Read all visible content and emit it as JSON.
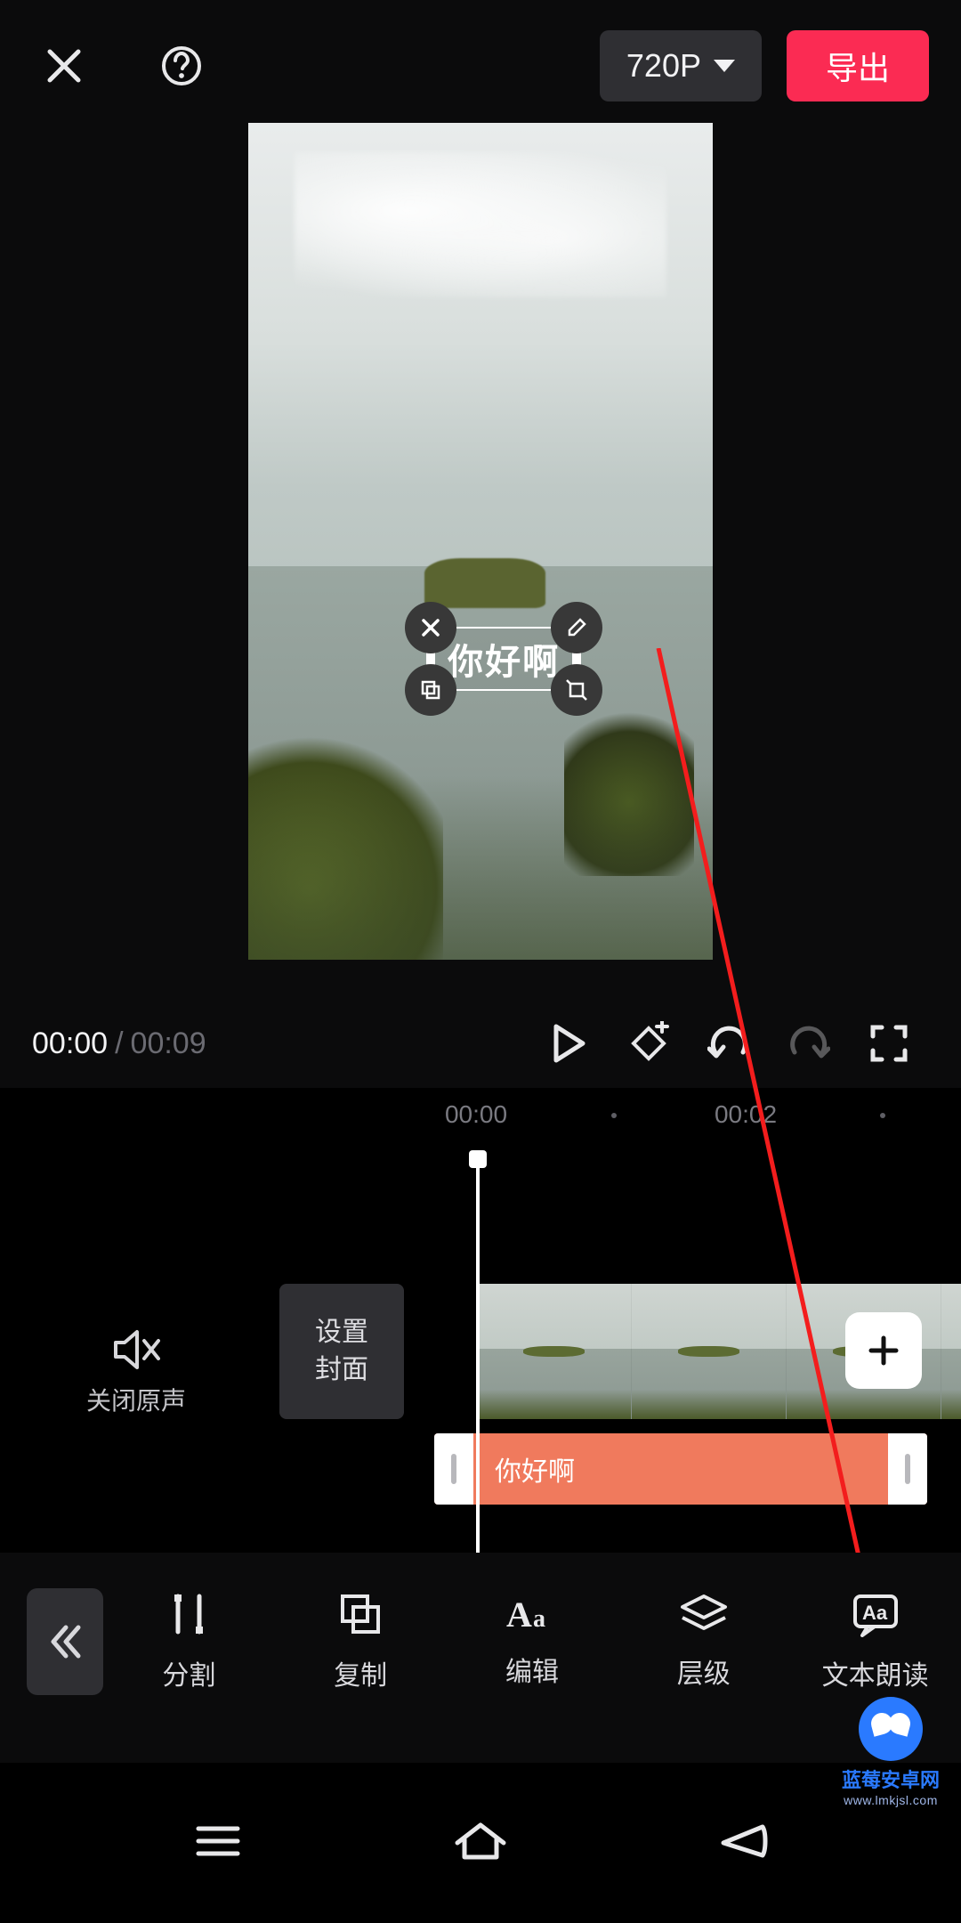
{
  "header": {
    "resolution_label": "720P",
    "export_label": "导出"
  },
  "preview": {
    "text_overlay": "你好啊"
  },
  "transport": {
    "current_time": "00:00",
    "separator": "/",
    "duration": "00:09"
  },
  "timeline": {
    "ruler": {
      "ticks": [
        "00:00",
        "00:02"
      ]
    },
    "audio_off_label": "关闭原声",
    "cover_button_label": "设置\n封面",
    "text_clip_label": "你好啊"
  },
  "bottom_toolbar": {
    "split_label": "分割",
    "copy_label": "复制",
    "edit_label": "编辑",
    "layer_label": "层级",
    "tts_label": "文本朗读"
  },
  "watermark": {
    "line1": "蓝莓安卓网",
    "line2": "www.lmkjsl.com"
  },
  "colors": {
    "accent": "#fb2b53",
    "text_clip": "#f07a5d",
    "arrow": "#f31d1d"
  }
}
